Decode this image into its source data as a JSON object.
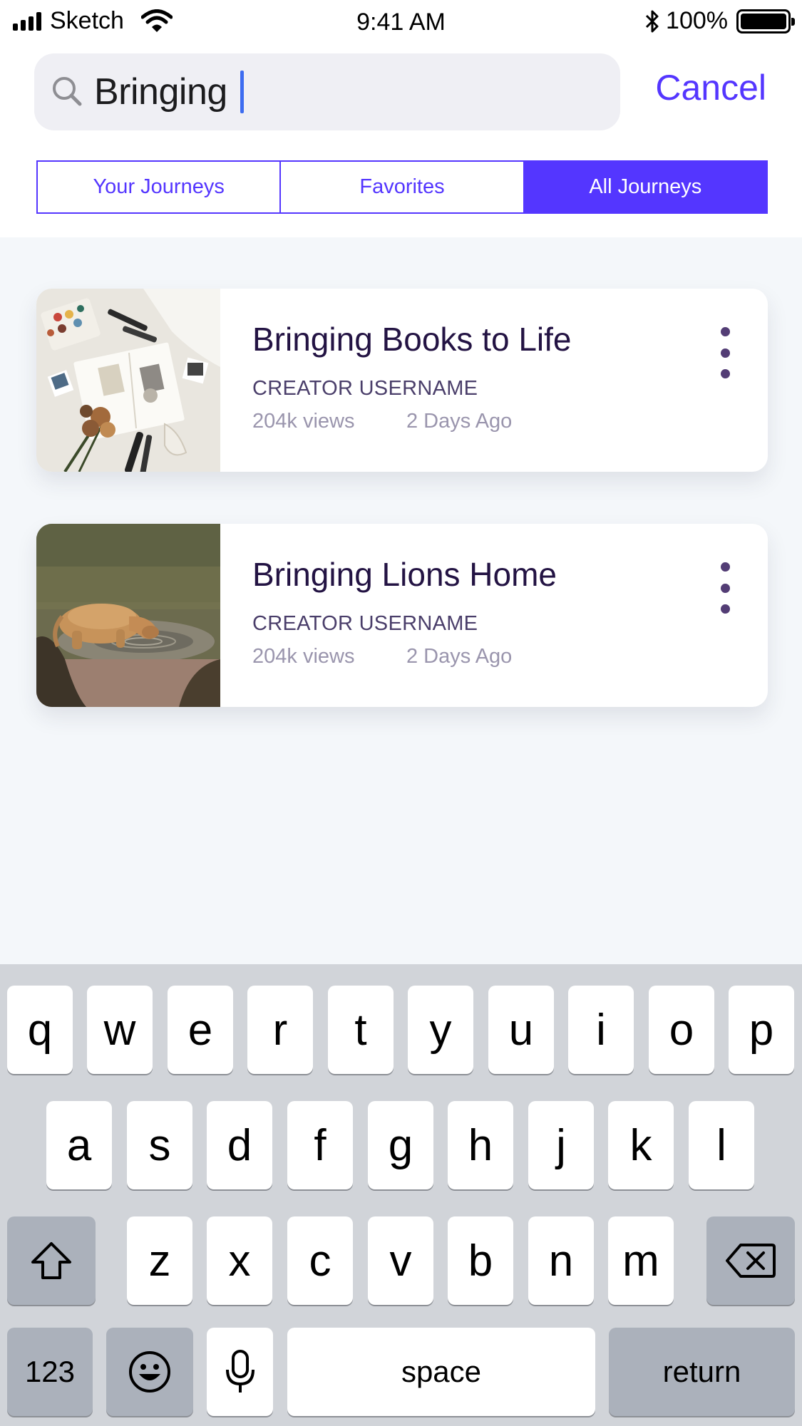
{
  "status_bar": {
    "carrier": "Sketch",
    "time": "9:41 AM",
    "battery": "100%"
  },
  "search": {
    "query": "Bringing",
    "cancel_label": "Cancel"
  },
  "tabs": [
    {
      "label": "Your Journeys",
      "active": false
    },
    {
      "label": "Favorites",
      "active": false
    },
    {
      "label": "All Journeys",
      "active": true
    }
  ],
  "results": [
    {
      "title": "Bringing Books to Life",
      "creator": "CREATOR USERNAME",
      "views": "204k views",
      "date": "2 Days Ago",
      "thumbnail": "flat-lay-journal-flowers-photo"
    },
    {
      "title": "Bringing Lions Home",
      "creator": "CREATOR USERNAME",
      "views": "204k views",
      "date": "2 Days Ago",
      "thumbnail": "lioness-drinking-water-photo"
    }
  ],
  "keyboard": {
    "row1": [
      "q",
      "w",
      "e",
      "r",
      "t",
      "y",
      "u",
      "i",
      "o",
      "p"
    ],
    "row2": [
      "a",
      "s",
      "d",
      "f",
      "g",
      "h",
      "j",
      "k",
      "l"
    ],
    "row3": [
      "z",
      "x",
      "c",
      "v",
      "b",
      "n",
      "m"
    ],
    "numbers_label": "123",
    "space_label": "space",
    "return_label": "return"
  },
  "colors": {
    "accent": "#5436ff",
    "title_text": "#231343",
    "meta_text": "#9a95ad",
    "results_background": "#f4f7fa",
    "keyboard_background": "#d1d4d9"
  }
}
